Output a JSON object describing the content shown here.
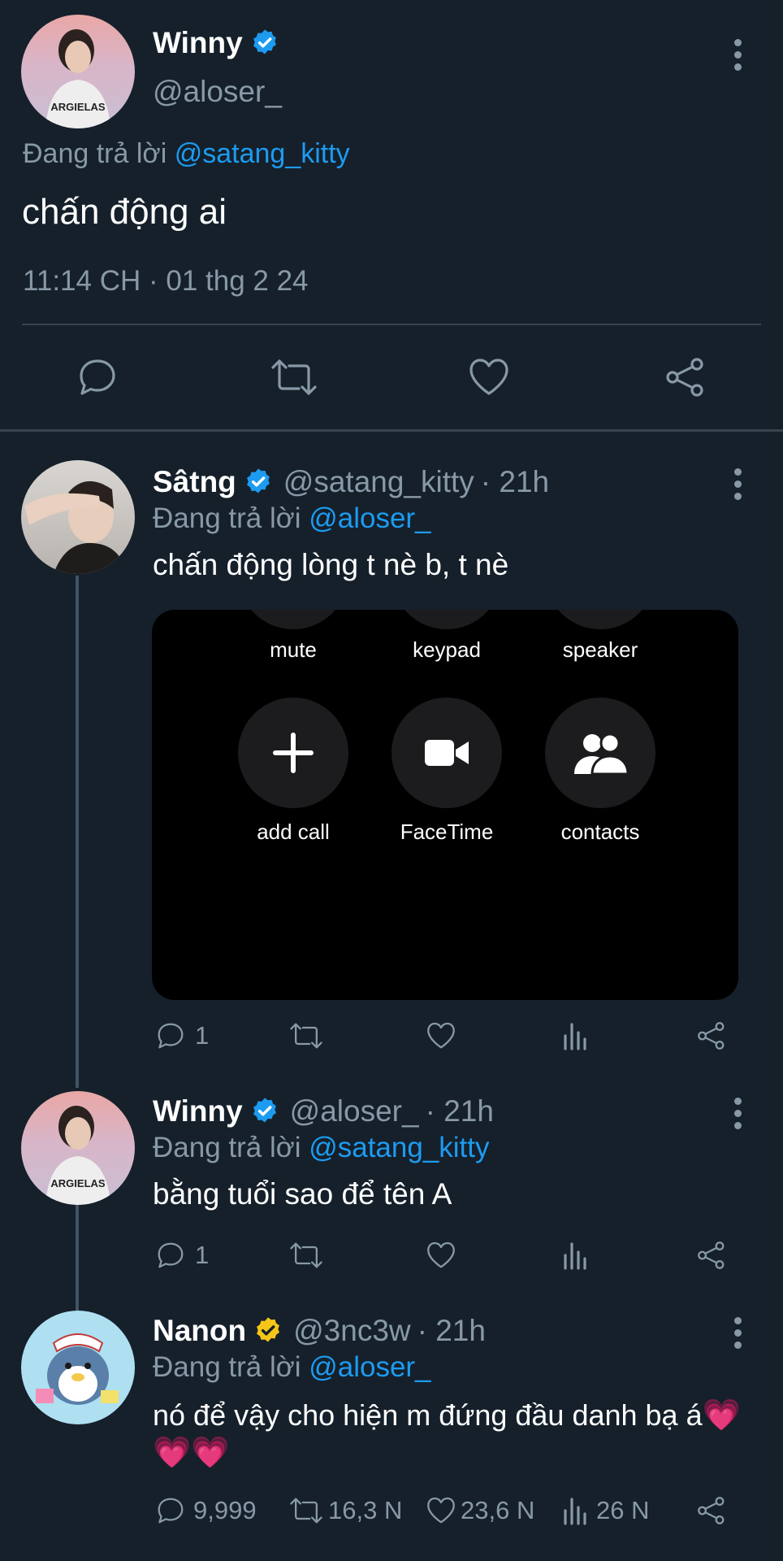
{
  "main_tweet": {
    "name": "Winny",
    "handle": "@aloser_",
    "reply_prefix": "Đang trả lời",
    "reply_to": "@satang_kitty",
    "text": "chấn động ai",
    "timestamp": "11:14 CH · 01 thg 2 24",
    "avatar_text": "ARGIELAS"
  },
  "replies": [
    {
      "name": "Sâtng",
      "handle": "@satang_kitty",
      "time": "· 21h",
      "reply_prefix": "Đang trả lời",
      "reply_to": "@aloser_",
      "text": "chấn động lòng t nè b, t nè",
      "reply_count": "1"
    },
    {
      "name": "Winny",
      "handle": "@aloser_",
      "time": "· 21h",
      "reply_prefix": "Đang trả lời",
      "reply_to": "@satang_kitty",
      "text": "bằng tuổi sao để tên A",
      "reply_count": "1",
      "avatar_text": "ARGIELAS"
    },
    {
      "name": "Nanon",
      "handle": "@3nc3w",
      "time": "· 21h",
      "reply_prefix": "Đang trả lời",
      "reply_to": "@aloser_",
      "text": "nó để vậy cho hiện m đứng đầu danh bạ á",
      "emoji": "💗💗💗",
      "reply_count": "9,999",
      "retweet_count": "16,3 N",
      "like_count": "23,6 N",
      "view_count": "26 N"
    }
  ],
  "call_screen": {
    "top_labels": [
      "mute",
      "keypad",
      "speaker"
    ],
    "buttons": [
      "add call",
      "FaceTime",
      "contacts"
    ]
  },
  "colors": {
    "background": "#15202b",
    "accent": "#1d9bf0",
    "muted": "#8899a6",
    "gold_verified": "#f5c518"
  }
}
